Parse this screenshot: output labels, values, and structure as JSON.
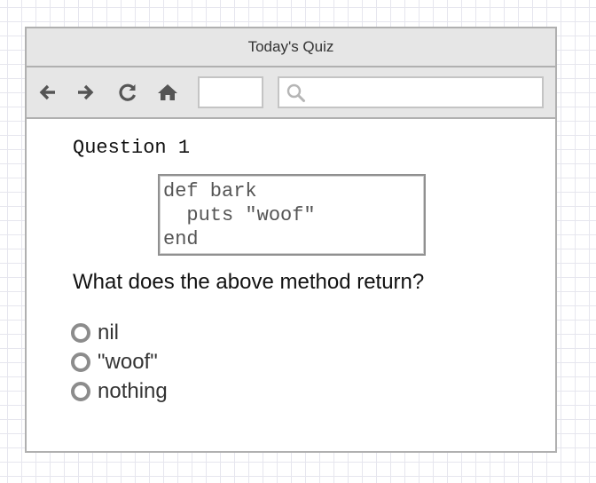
{
  "window": {
    "title": "Today's Quiz"
  },
  "toolbar": {
    "icons": [
      "back-arrow-icon",
      "forward-arrow-icon",
      "reload-icon",
      "home-icon",
      "search-icon"
    ],
    "url_value": "",
    "search_value": ""
  },
  "quiz": {
    "heading": "Question 1",
    "code_lines": [
      "def bark",
      "  puts \"woof\"",
      "end"
    ],
    "prompt": "What does the above method return?",
    "options": [
      {
        "label": "nil",
        "selected": false
      },
      {
        "label": "\"woof\"",
        "selected": false
      },
      {
        "label": "nothing",
        "selected": false
      }
    ]
  },
  "colors": {
    "chrome": "#e6e6e6",
    "border": "#b0b0b0",
    "grid": "#e6e6ee",
    "icon": "#555555"
  }
}
